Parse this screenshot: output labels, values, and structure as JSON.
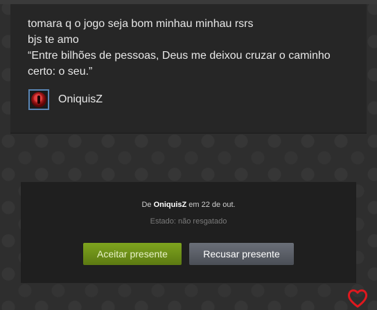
{
  "message": {
    "lines": [
      "tomara q o jogo seja bom minhau minhau rsrs",
      "bjs te amo",
      "“Entre bilhões de pessoas, Deus me deixou cruzar o caminho",
      "certo: o seu.”"
    ],
    "sender_name": "OniquisZ"
  },
  "gift": {
    "from_prefix": "De ",
    "from_name": "OniquisZ",
    "from_suffix": " em 22 de out.",
    "status": "Estado: não resgatado",
    "accept_label": "Aceitar presente",
    "decline_label": "Recusar presente"
  },
  "colors": {
    "accent_green": "#6b8f18",
    "heart_red": "#e0181e",
    "avatar_border": "#5a86b5"
  },
  "icons": {
    "avatar": "user-avatar",
    "corner": "heart-icon"
  }
}
